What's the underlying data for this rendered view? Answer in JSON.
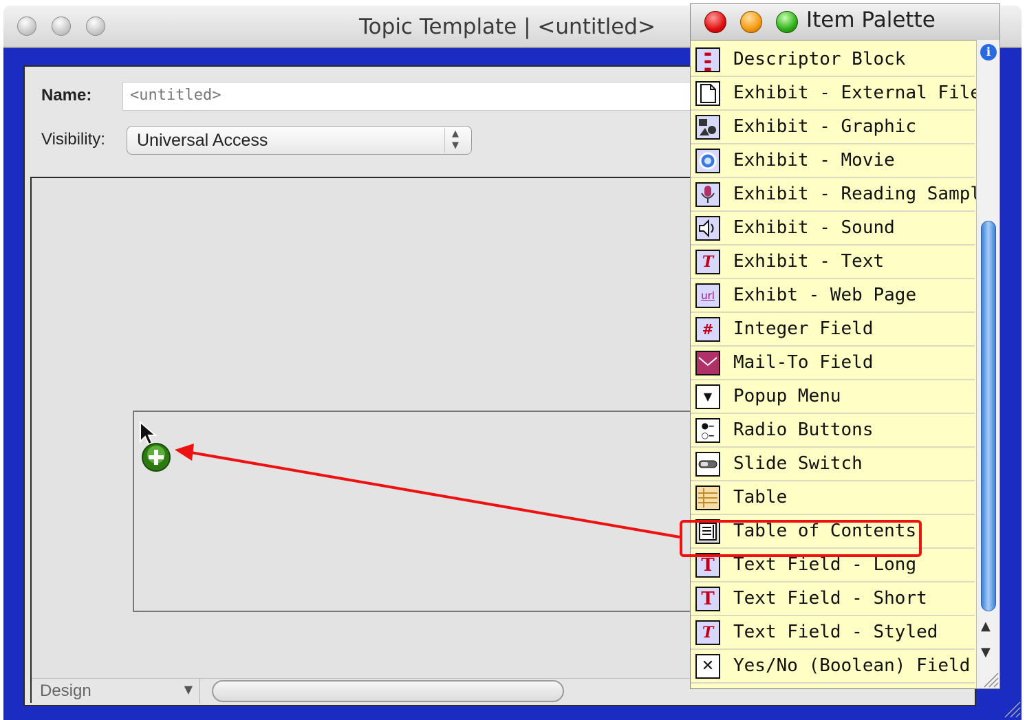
{
  "main_window": {
    "title": "Topic Template | <untitled>",
    "name_label": "Name:",
    "name_value": "<untitled>",
    "visibility_label": "Visibility:",
    "visibility_value": "Universal Access",
    "view_mode": "Design"
  },
  "palette": {
    "title": "Item Palette",
    "items": [
      {
        "label": "Descriptor Block",
        "icon": "descriptor-block-icon"
      },
      {
        "label": "Exhibit - External File",
        "icon": "document-icon"
      },
      {
        "label": "Exhibit - Graphic",
        "icon": "graphic-icon"
      },
      {
        "label": "Exhibit - Movie",
        "icon": "quicktime-icon"
      },
      {
        "label": "Exhibit - Reading Sample",
        "icon": "microphone-icon"
      },
      {
        "label": "Exhibit - Sound",
        "icon": "speaker-icon"
      },
      {
        "label": "Exhibit - Text",
        "icon": "styled-text-icon"
      },
      {
        "label": "Exhibt - Web Page",
        "icon": "url-icon"
      },
      {
        "label": "Integer Field",
        "icon": "hash-icon"
      },
      {
        "label": "Mail-To Field",
        "icon": "envelope-icon"
      },
      {
        "label": "Popup Menu",
        "icon": "popup-menu-icon"
      },
      {
        "label": "Radio Buttons",
        "icon": "radio-buttons-icon"
      },
      {
        "label": "Slide Switch",
        "icon": "slide-switch-icon"
      },
      {
        "label": "Table",
        "icon": "table-icon"
      },
      {
        "label": "Table of Contents",
        "icon": "table-of-contents-icon"
      },
      {
        "label": "Text Field - Long",
        "icon": "text-long-icon"
      },
      {
        "label": "Text Field - Short",
        "icon": "text-short-icon"
      },
      {
        "label": "Text Field - Styled",
        "icon": "styled-text-icon"
      },
      {
        "label": "Yes/No (Boolean) Field",
        "icon": "checkbox-x-icon"
      }
    ],
    "highlighted_item": "Table of Contents"
  },
  "colors": {
    "window_blue": "#1a2cc2",
    "palette_bg": "#ffffc5",
    "highlight_red": "#ee1111",
    "arrow_red": "#ee1111",
    "add_badge_green": "#3a9a1a"
  }
}
